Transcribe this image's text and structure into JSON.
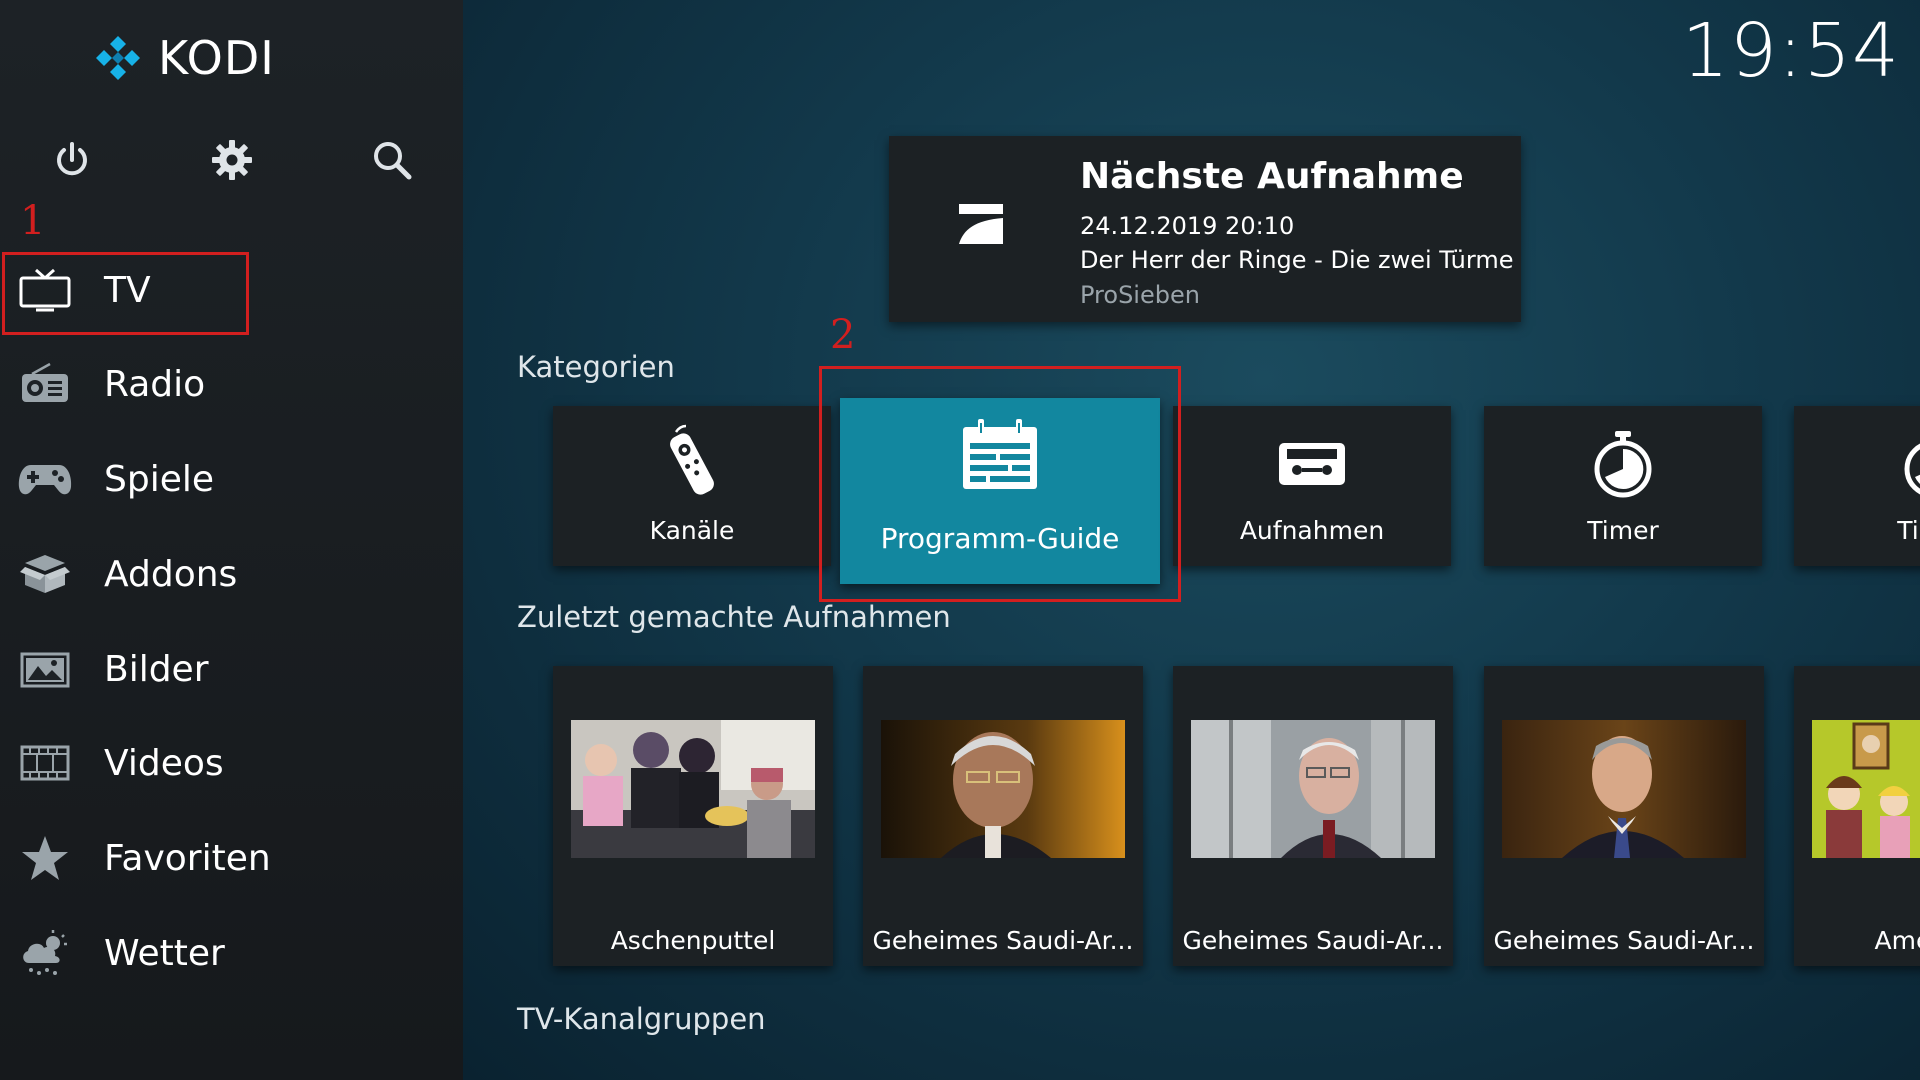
{
  "app": {
    "name": "KODI",
    "clock": "19:54"
  },
  "annotations": {
    "marker_1": "1",
    "marker_2": "2"
  },
  "top_icons": [
    "power-icon",
    "gear-icon",
    "search-icon"
  ],
  "sidebar": {
    "items": [
      {
        "label": "TV",
        "icon": "tv-icon"
      },
      {
        "label": "Radio",
        "icon": "radio-icon"
      },
      {
        "label": "Spiele",
        "icon": "gamepad-icon"
      },
      {
        "label": "Addons",
        "icon": "box-icon"
      },
      {
        "label": "Bilder",
        "icon": "picture-icon"
      },
      {
        "label": "Videos",
        "icon": "film-icon"
      },
      {
        "label": "Favoriten",
        "icon": "star-icon"
      },
      {
        "label": "Wetter",
        "icon": "weather-icon"
      }
    ]
  },
  "next_recording": {
    "title": "Nächste Aufnahme",
    "datetime": "24.12.2019 20:10",
    "program": "Der Herr der Ringe - Die zwei Türme",
    "channel": "ProSieben"
  },
  "categories": {
    "title": "Kategorien",
    "items": [
      {
        "label": "Kanäle",
        "icon": "remote-icon"
      },
      {
        "label": "Programm-Guide",
        "icon": "calendar-icon",
        "focused": true
      },
      {
        "label": "Aufnahmen",
        "icon": "cassette-icon"
      },
      {
        "label": "Timer",
        "icon": "stopwatch-icon"
      },
      {
        "label": "Timer",
        "icon": "stopwatch-icon"
      }
    ]
  },
  "recent_recordings": {
    "title": "Zuletzt gemachte Aufnahmen",
    "items": [
      {
        "title": "Aschenputtel"
      },
      {
        "title": "Geheimes Saudi-Ar..."
      },
      {
        "title": "Geheimes Saudi-Ar..."
      },
      {
        "title": "Geheimes Saudi-Ar..."
      },
      {
        "title": "American"
      }
    ]
  },
  "channel_groups": {
    "title": "TV-Kanalgruppen"
  },
  "colors": {
    "focus": "#12879f",
    "annotation": "#d21f1f",
    "tile": "#1c2124",
    "sidebar": "#1d2226"
  }
}
